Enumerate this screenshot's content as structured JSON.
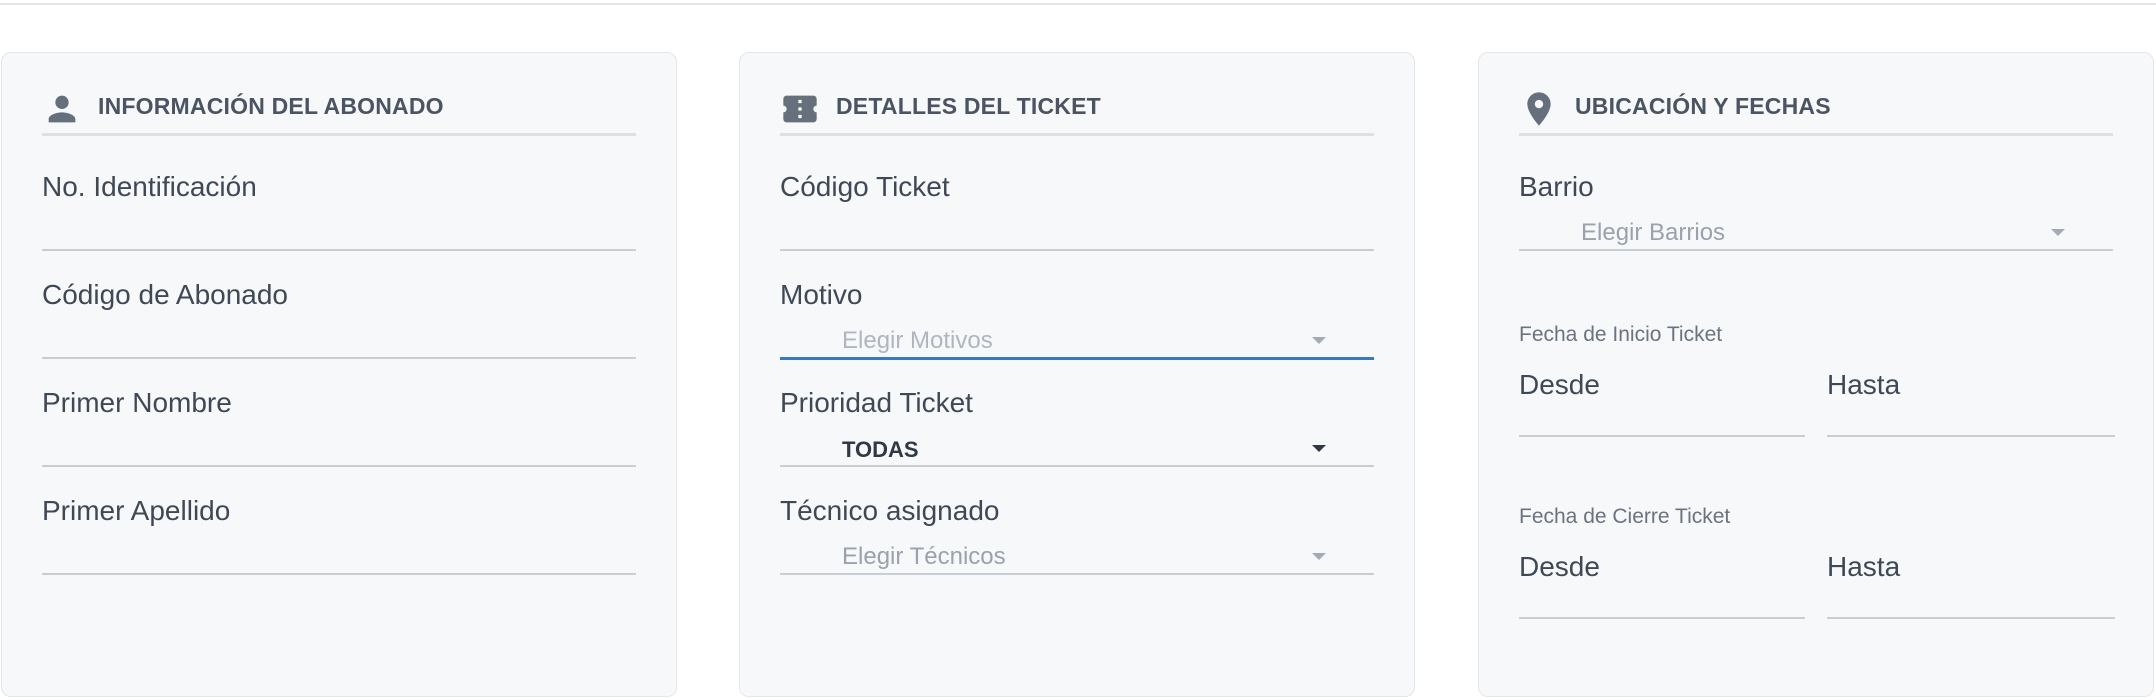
{
  "panels": {
    "subscriber": {
      "title": "INFORMACIÓN DEL ABONADO",
      "icon": "person-icon",
      "fields": [
        {
          "label": "No. Identificación",
          "value": ""
        },
        {
          "label": "Código de Abonado",
          "value": ""
        },
        {
          "label": "Primer Nombre",
          "value": ""
        },
        {
          "label": "Primer Apellido",
          "value": ""
        }
      ]
    },
    "ticket": {
      "title": "DETALLES DEL TICKET",
      "icon": "ticket-icon",
      "fields": [
        {
          "label": "Código Ticket",
          "value": ""
        },
        {
          "label": "Motivo",
          "placeholder": "Elegir Motivos"
        },
        {
          "label": "Prioridad Ticket",
          "selected": "TODAS"
        },
        {
          "label": "Técnico asignado",
          "placeholder": "Elegir Técnicos"
        }
      ]
    },
    "location": {
      "title": "UBICACIÓN Y FECHAS",
      "icon": "location-pin-icon",
      "barrio": {
        "label": "Barrio",
        "placeholder": "Elegir Barrios"
      },
      "start_dates": {
        "title": "Fecha de Inicio Ticket",
        "from": "Desde",
        "to": "Hasta"
      },
      "close_dates": {
        "title": "Fecha de Cierre Ticket",
        "from": "Desde",
        "to": "Hasta"
      }
    }
  },
  "colors": {
    "accent": "#3b78c4",
    "panel_bg": "#f7f8fa",
    "icon": "#66707c"
  }
}
